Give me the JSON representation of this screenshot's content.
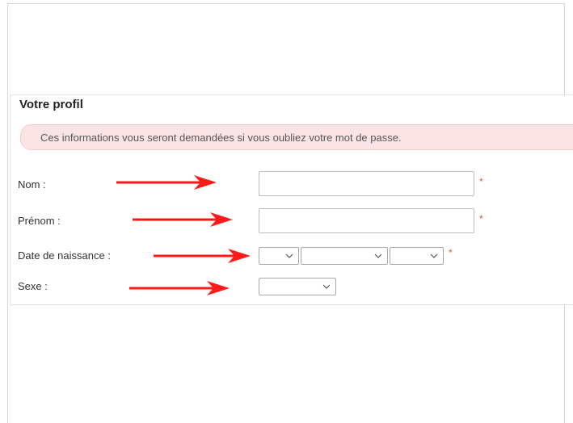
{
  "profile": {
    "title": "Votre profil",
    "info_message": "Ces informations vous seront demandées si vous oubliez votre mot de passe.",
    "required_marker": "*",
    "fields": {
      "nom_label": "Nom :",
      "prenom_label": "Prénom :",
      "date_label": "Date de naissance :",
      "sexe_label": "Sexe :"
    }
  },
  "colors": {
    "info_background": "#fbe4e6",
    "arrow": "#ff1a1a",
    "required": "#e34b4b"
  },
  "icons": [
    "right-arrow-icon",
    "chevron-down-icon"
  ]
}
